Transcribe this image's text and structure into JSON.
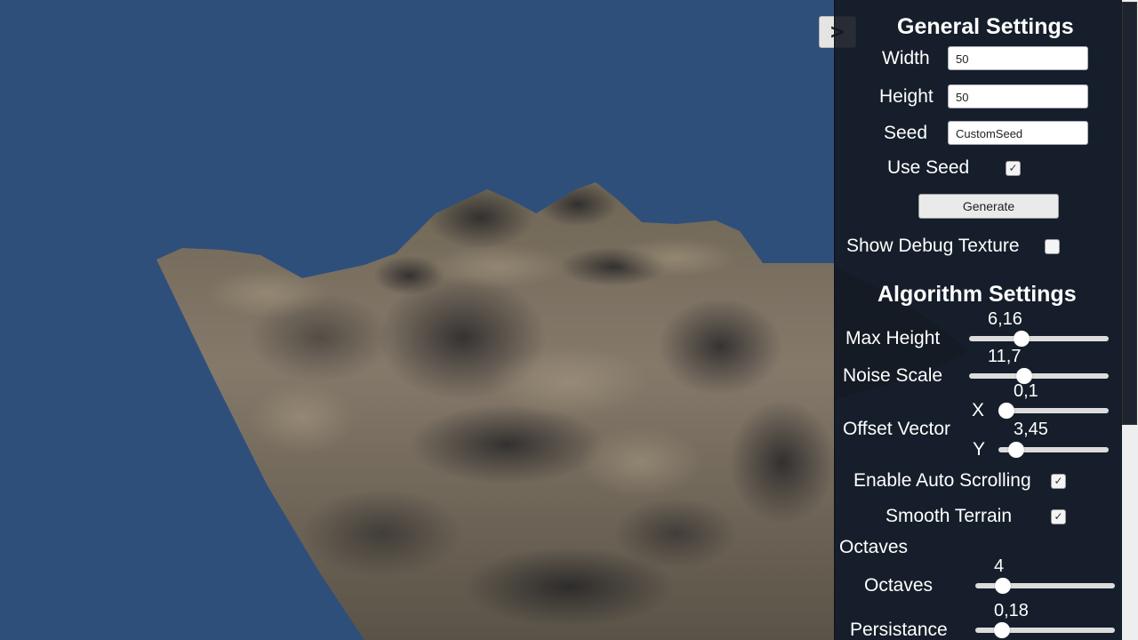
{
  "toggle": {
    "label": ">"
  },
  "general": {
    "title": "General Settings",
    "width": {
      "label": "Width",
      "value": "50"
    },
    "height": {
      "label": "Height",
      "value": "50"
    },
    "seed": {
      "label": "Seed",
      "value": "CustomSeed"
    },
    "use_seed": {
      "label": "Use Seed",
      "checked": true,
      "mark": "✓"
    },
    "generate_label": "Generate",
    "debug_texture": {
      "label": "Show Debug Texture",
      "checked": false
    }
  },
  "algorithm": {
    "title": "Algorithm Settings",
    "max_height": {
      "label": "Max Height",
      "value": "6,16",
      "fraction": 0.36
    },
    "noise_scale": {
      "label": "Noise Scale",
      "value": "11,7",
      "fraction": 0.38
    },
    "offset": {
      "label": "Offset Vector",
      "x": {
        "label": "X",
        "value": "0,1",
        "fraction": 0.0
      },
      "y": {
        "label": "Y",
        "value": "3,45",
        "fraction": 0.1
      }
    },
    "auto_scroll": {
      "label": "Enable Auto Scrolling",
      "checked": true,
      "mark": "✓"
    },
    "smooth": {
      "label": "Smooth Terrain",
      "checked": true,
      "mark": "✓"
    }
  },
  "octaves_section": {
    "title": "Octaves",
    "octaves": {
      "label": "Octaves",
      "value": "4",
      "fraction": 0.16
    },
    "persistance": {
      "label": "Persistance",
      "value": "0,18",
      "fraction": 0.15
    }
  },
  "colors": {
    "sky": "#2f4f7b",
    "terrain_light": "#8a7f6d",
    "terrain_dark": "#2a2a2d"
  }
}
